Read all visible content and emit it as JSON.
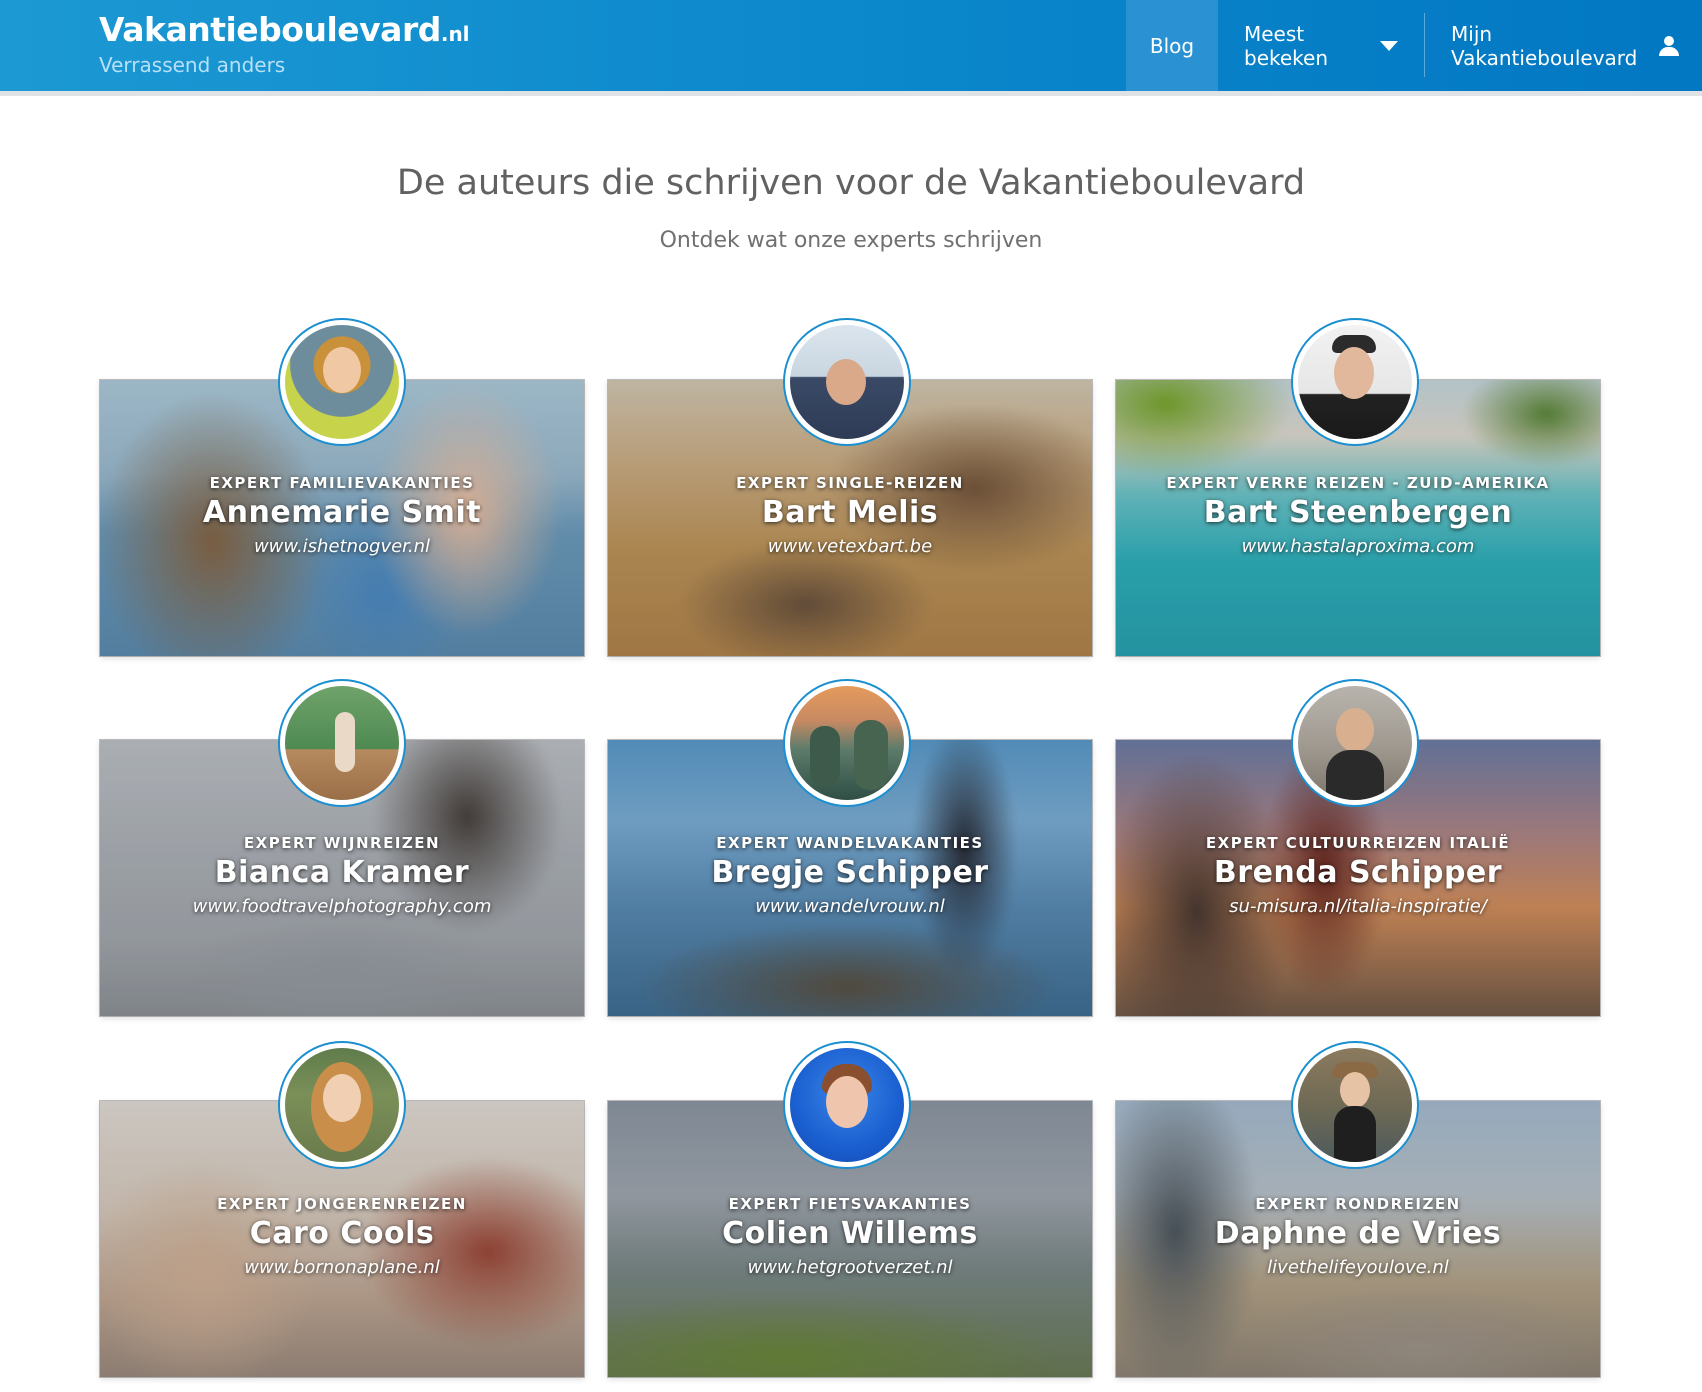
{
  "header": {
    "brand_name": "Vakantieboulevard",
    "brand_tld": ".nl",
    "tagline": "Verrassend anders",
    "nav": {
      "blog": "Blog",
      "most_viewed": "Meest bekeken",
      "account": "Mijn Vakantieboulevard"
    }
  },
  "intro": {
    "title": "De auteurs die schrijven voor de Vakantieboulevard",
    "subtitle": "Ontdek wat onze experts schrijven"
  },
  "authors": [
    {
      "role": "Expert familievakanties",
      "name": "Annemarie Smit",
      "site": "www.ishetnogver.nl"
    },
    {
      "role": "Expert single-reizen",
      "name": "Bart Melis",
      "site": "www.vetexbart.be"
    },
    {
      "role": "Expert verre reizen - Zuid-Amerika",
      "name": "Bart Steenbergen",
      "site": "www.hastalaproxima.com"
    },
    {
      "role": "Expert wijnreizen",
      "name": "Bianca Kramer",
      "site": "www.foodtravelphotography.com"
    },
    {
      "role": "Expert wandelvakanties",
      "name": "Bregje Schipper",
      "site": "www.wandelvrouw.nl"
    },
    {
      "role": "Expert cultuurreizen Italië",
      "name": "Brenda Schipper",
      "site": "su-misura.nl/italia-inspiratie/"
    },
    {
      "role": "Expert jongerenreizen",
      "name": "Caro Cools",
      "site": "www.bornonaplane.nl"
    },
    {
      "role": "Expert fietsvakanties",
      "name": "Colien Willems",
      "site": "www.hetgrootverzet.nl"
    },
    {
      "role": "Expert rondreizen",
      "name": "Daphne de Vries",
      "site": "livethelifeyoulove.nl"
    }
  ]
}
